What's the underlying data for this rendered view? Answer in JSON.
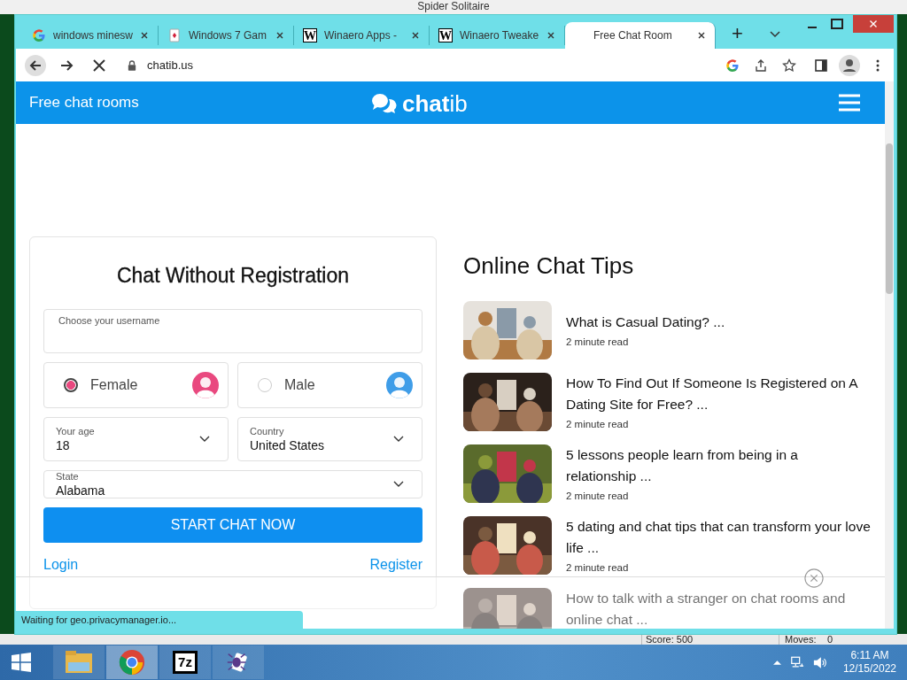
{
  "background_window": {
    "title": "Spider Solitaire",
    "score": "Score: 500",
    "moves_label": "Moves:",
    "moves_value": "0"
  },
  "browser": {
    "tabs": [
      {
        "label": "windows minesw",
        "kind": "google",
        "selected": false
      },
      {
        "label": "Windows 7 Gam",
        "kind": "cards",
        "selected": false
      },
      {
        "label": "Winaero Apps -",
        "kind": "lettered",
        "icon_text": "W",
        "selected": false
      },
      {
        "label": "Winaero Tweake",
        "kind": "lettered",
        "icon_text": "W",
        "selected": false
      },
      {
        "label": "Free Chat Room",
        "kind": "plain",
        "selected": true
      }
    ],
    "new_tab": "+",
    "address": "chatib.us",
    "status": "Waiting for geo.privacymanager.io..."
  },
  "site": {
    "nav_title": "Free chat rooms",
    "logo_bold": "chat",
    "logo_light": "ib"
  },
  "form": {
    "title": "Chat Without Registration",
    "username_placeholder": "Choose your username",
    "genders": [
      {
        "label": "Female",
        "selected": true,
        "color": "#e9497f"
      },
      {
        "label": "Male",
        "selected": false,
        "color": "#3f9de8"
      }
    ],
    "selects": [
      {
        "label": "Your age",
        "value": "18"
      },
      {
        "label": "Country",
        "value": "United States"
      }
    ],
    "state": {
      "label": "State",
      "value": "Alabama"
    },
    "button": "START CHAT NOW",
    "login": "Login",
    "register": "Register"
  },
  "tips": {
    "heading": "Online Chat Tips",
    "articles": [
      {
        "title": "What is Casual Dating? ...",
        "meta": "2 minute read"
      },
      {
        "title": "How To Find Out If Someone Is Registered on A Dating Site for Free? ...",
        "meta": "2 minute read"
      },
      {
        "title": "5 lessons people learn from being in a relationship ...",
        "meta": "2 minute read"
      },
      {
        "title": "5 dating and chat tips that can transform your love life ...",
        "meta": "2 minute read"
      },
      {
        "title": "How to talk with a stranger on chat rooms and online chat ..."
      }
    ]
  },
  "taskbar": {
    "apps": [
      {
        "kind": "explorer",
        "selected": false
      },
      {
        "kind": "chrome",
        "selected": true
      },
      {
        "kind": "sevenzip",
        "text": "7z",
        "selected": false
      },
      {
        "kind": "spider",
        "selected": false
      }
    ],
    "time": "6:11 AM",
    "date": "12/15/2022"
  }
}
